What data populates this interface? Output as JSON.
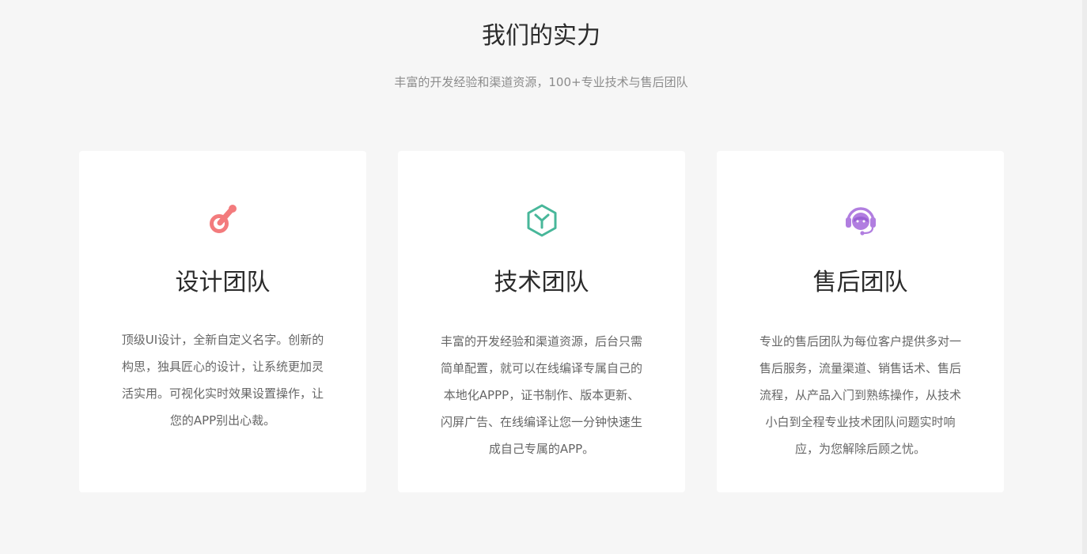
{
  "section": {
    "title": "我们的实力",
    "subtitle": "丰富的开发经验和渠道资源，100+专业技术与售后团队"
  },
  "cards": [
    {
      "icon": "brush-icon",
      "icon_color": "#f37b7d",
      "title": "设计团队",
      "description": "顶级UI设计，全新自定义名字。创新的构思，独具匠心的设计，让系统更加灵活实用。可视化实时效果设置操作，让您的APP别出心裁。"
    },
    {
      "icon": "cube-icon",
      "icon_color": "#48b79a",
      "title": "技术团队",
      "description": "丰富的开发经验和渠道资源，后台只需简单配置，就可以在线编译专属自己的本地化APPP，证书制作、版本更新、闪屏广告、在线编译让您一分钟快速生成自己专属的APP。"
    },
    {
      "icon": "headset-icon",
      "icon_color": "#b17ee0",
      "title": "售后团队",
      "description": "专业的售后团队为每位客户提供多对一售后服务，流量渠道、销售话术、售后流程，从产品入门到熟练操作，从技术小白到全程专业技术团队问题实时响应，为您解除后顾之忧。"
    }
  ]
}
